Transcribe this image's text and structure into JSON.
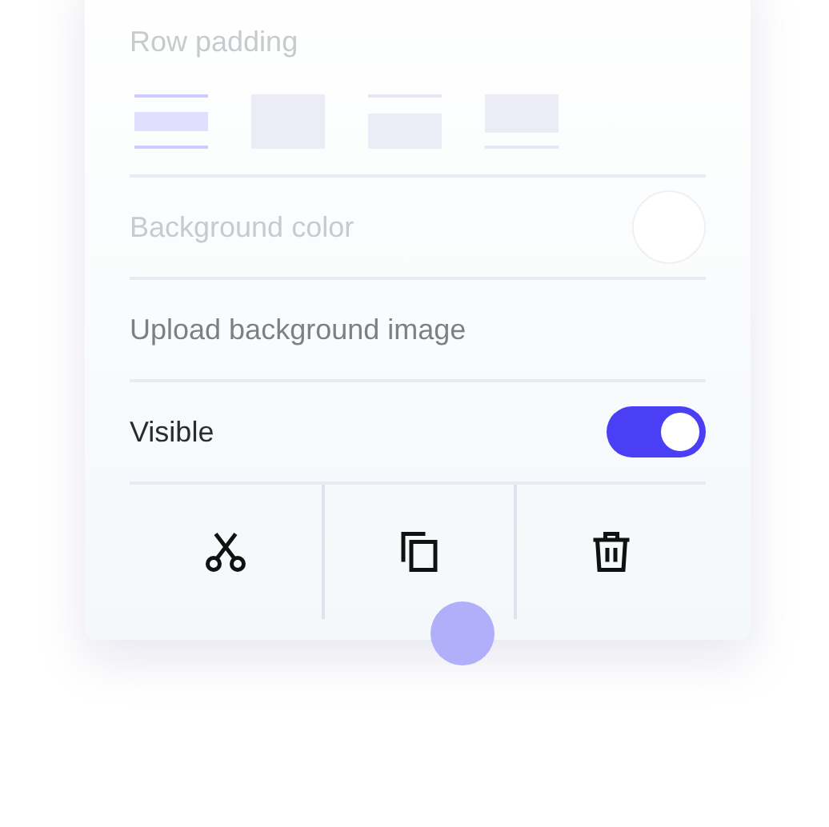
{
  "row_padding": {
    "label": "Row padding",
    "disabled": true,
    "options": [
      {
        "kind": "both",
        "selected": true
      },
      {
        "kind": "none",
        "selected": false
      },
      {
        "kind": "top",
        "selected": false
      },
      {
        "kind": "bottom",
        "selected": false
      }
    ]
  },
  "rows": [
    {
      "kind": "color",
      "label": "Background color",
      "disabled": true,
      "color": "#ffffff"
    },
    {
      "kind": "upload",
      "label": "Upload background image",
      "disabled": false
    },
    {
      "kind": "toggle",
      "label": "Visible",
      "disabled": false,
      "on": true
    }
  ],
  "actions": [
    {
      "kind": "cut"
    },
    {
      "kind": "copy"
    },
    {
      "kind": "delete"
    }
  ]
}
